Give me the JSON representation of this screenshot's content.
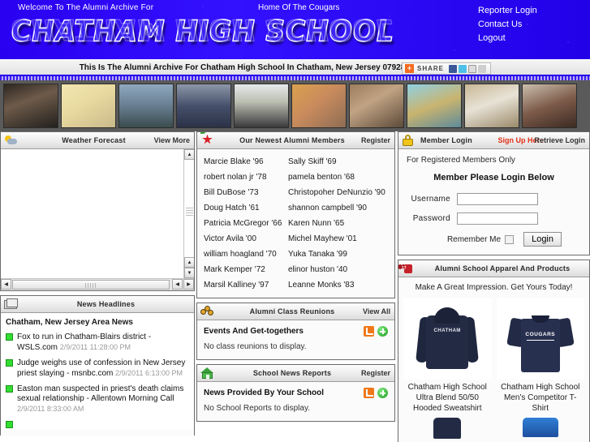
{
  "banner": {
    "welcome": "Welcome To The Alumni Archive For",
    "tagline": "Home Of The Cougars",
    "school_title": "CHATHAM HIGH SCHOOL",
    "bg_color": "#2200ee",
    "title_color": "#3b23f5",
    "nav": [
      {
        "label": "Reporter Login"
      },
      {
        "label": "Contact Us"
      },
      {
        "label": "Logout"
      }
    ]
  },
  "subbar": {
    "text": "This Is The Alumni Archive For Chatham High School In Chatham, New Jersey 07928",
    "share": {
      "plus": "+",
      "label": "SHARE",
      "icons": [
        "facebook-icon",
        "twitter-icon",
        "email-icon",
        "more-icon"
      ]
    }
  },
  "photostrip": {
    "count": 10,
    "photos": [
      {
        "alt": "two-people-photo"
      },
      {
        "alt": "baby-photo"
      },
      {
        "alt": "beach-photo"
      },
      {
        "alt": "team-group-photo"
      },
      {
        "alt": "man-in-suit-photo"
      },
      {
        "alt": "woman-portrait-photo"
      },
      {
        "alt": "family-indoor-photo"
      },
      {
        "alt": "blonde-woman-photo"
      },
      {
        "alt": "child-winter-hat-photo"
      },
      {
        "alt": "woman-interior-photo"
      }
    ]
  },
  "weather": {
    "title": "Weather Forecast",
    "link": "View More",
    "icon": "sun-cloud-icon",
    "content": ""
  },
  "news": {
    "title": "News Headlines",
    "icon": "newspaper-icon",
    "area_title": "Chatham, New Jersey Area News",
    "items": [
      {
        "headline": "Fox to run in Chatham-Blairs district - WSLS.com",
        "date": "2/9/2011 11:28:00 PM"
      },
      {
        "headline": "Judge weighs use of confession in New Jersey priest slaying - msnbc.com",
        "date": "2/9/2011 6:13:00 PM"
      },
      {
        "headline": "Easton man suspected in priest's death claims sexual relationship - Allentown Morning Call",
        "date": "2/9/2011 8:33:00 AM"
      }
    ]
  },
  "members": {
    "title": "Our Newest Alumni Members",
    "link": "Register",
    "icon": "red-star-icon",
    "left_column": [
      "Marcie Blake '96",
      "robert nolan jr '78",
      "Bill DuBose '73",
      "Doug Hatch '61",
      "Patricia McGregor '66",
      "Victor Avila '00",
      "william hoagland '70",
      "Mark Kemper '72",
      "Marsil Kalliney '97"
    ],
    "right_column": [
      "Sally Skiff '69",
      "pamela benton '68",
      "Christopoher DeNunzio '90",
      "shannon campbell '90",
      "Karen Nunn '65",
      "Michel Mayhew '01",
      "Yuka Tanaka '99",
      "elinor huston '40",
      "Leanne Monks '83"
    ]
  },
  "reunions": {
    "title": "Alumni Class Reunions",
    "link": "View All",
    "icon": "bees-icon",
    "section_title": "Events And Get-togethers",
    "empty_text": "No class reunions to display.",
    "action_icons": [
      "rss-icon",
      "add-icon"
    ]
  },
  "school_news": {
    "title": "School News Reports",
    "link": "Register",
    "icon": "green-house-icon",
    "section_title": "News Provided By Your School",
    "empty_text": "No School Reports to display.",
    "action_icons": [
      "rss-icon",
      "add-icon"
    ]
  },
  "login": {
    "title": "Member Login",
    "icon": "gold-lock-icon",
    "signup_link": "Sign Up Here",
    "signup_color": "#e03018",
    "retrieve_link": "Retrieve Login",
    "note": "For Registered Members Only",
    "heading": "Member Please Login Below",
    "username_label": "Username",
    "username_value": "",
    "password_label": "Password",
    "password_value": "",
    "remember_label": "Remember Me",
    "remember_checked": false,
    "login_button": "Login"
  },
  "apparel": {
    "title": "Alumni School Apparel And Products",
    "icon": "red-tshirt-icon",
    "tagline": "Make A Great Impression. Get Yours Today!",
    "products": [
      {
        "name": "Chatham High School Ultra Blend 50/50 Hooded Sweatshirt",
        "graphic_text": "CHATHAM",
        "image": "navy-hoodie"
      },
      {
        "name": "Chatham High School Men's Competitor T-Shirt",
        "graphic_text": "COUGARS",
        "image": "navy-tshirt"
      }
    ],
    "next_row": [
      {
        "image": "navy-product"
      },
      {
        "image": "blue-product"
      }
    ]
  }
}
